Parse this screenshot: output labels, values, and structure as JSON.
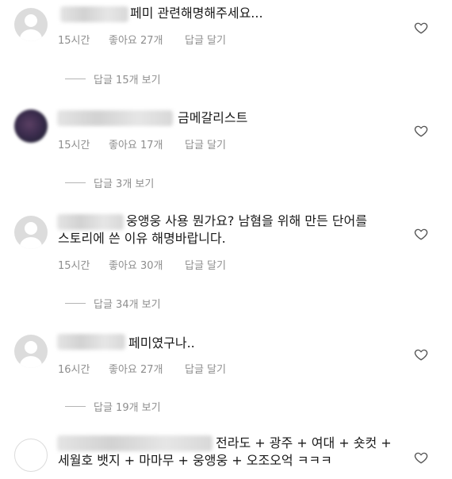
{
  "comments": [
    {
      "avatar": "default-avatar",
      "text_lines": [
        "페미 관련해명해주세요..."
      ],
      "time": "15시간",
      "likes": "좋아요 27개",
      "reply_action": "답글 달기",
      "view_replies": "답글 15개 보기"
    },
    {
      "avatar": "photo-avatar",
      "text_lines": [
        "금메갈리스트"
      ],
      "time": "15시간",
      "likes": "좋아요 17개",
      "reply_action": "답글 달기",
      "view_replies": "답글 3개 보기"
    },
    {
      "avatar": "default-avatar",
      "text_lines": [
        "웅앵웅 사용 뭔가요? 남혐을 위해 만든 단어를",
        "스토리에 쓴 이유 해명바랍니다."
      ],
      "time": "15시간",
      "likes": "좋아요 30개",
      "reply_action": "답글 달기",
      "view_replies": "답글 34개 보기"
    },
    {
      "avatar": "default-avatar",
      "text_lines": [
        "페미였구나.."
      ],
      "time": "16시간",
      "likes": "좋아요 27개",
      "reply_action": "답글 달기",
      "view_replies": "답글 19개 보기"
    },
    {
      "avatar": "empty-avatar",
      "text_lines": [
        "전라도 + 광주 + 여대 + 숏컷 +",
        "세월호 뱃지 + 마마무 + 웅앵웅 + 오조오억 ㅋㅋㅋ"
      ]
    }
  ],
  "icons": {
    "like": "heart-outline-icon"
  }
}
